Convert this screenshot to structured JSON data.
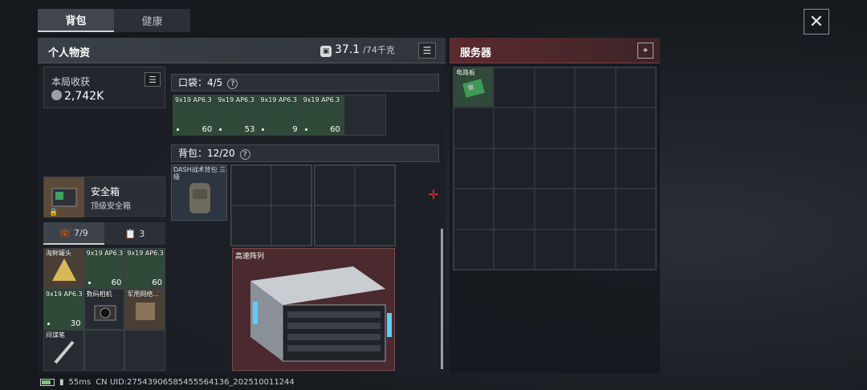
{
  "tabs": [
    {
      "label": "背包"
    },
    {
      "label": "健康"
    }
  ],
  "close_label": "✕",
  "personal": {
    "title": "个人物资",
    "weight_current": "37.1",
    "weight_max": "/74千克",
    "list_icon": "list-icon"
  },
  "server": {
    "title": "服务器",
    "item": "电路板",
    "pin_icon": "location-pin-icon"
  },
  "earnings": {
    "title": "本局收获",
    "value": "2,742K"
  },
  "safe": {
    "name": "安全箱",
    "sub": "顶级安全箱"
  },
  "subtabs": [
    {
      "label": "7/9",
      "icon": "briefcase-icon"
    },
    {
      "label": "3",
      "icon": "clipboard-icon"
    }
  ],
  "safe_items": [
    {
      "label": "海鲜罐头",
      "count": ""
    },
    {
      "label": "9x19 AP6.3",
      "count": "60"
    },
    {
      "label": "9x19 AP6.3",
      "count": "60"
    },
    {
      "label": "9x19 AP6.3",
      "count": "30"
    },
    {
      "label": "数码相机",
      "count": ""
    },
    {
      "label": "军用网络...",
      "count": ""
    },
    {
      "label": "间谍笔",
      "count": ""
    },
    {
      "label": "",
      "count": ""
    },
    {
      "label": "",
      "count": ""
    }
  ],
  "pocket": {
    "header": "口袋：4/5",
    "items": [
      {
        "label": "9x19 AP6.3",
        "count": "60"
      },
      {
        "label": "9x19 AP6.3",
        "count": "53"
      },
      {
        "label": "9x19 AP6.3",
        "count": "9"
      },
      {
        "label": "9x19 AP6.3",
        "count": "60"
      },
      {
        "label": "",
        "count": ""
      }
    ]
  },
  "bag": {
    "header": "背包：12/20",
    "backpack_label": "DASH战术背包 三级",
    "array_label": "高速阵列"
  },
  "status": {
    "ping": "55ms",
    "uid": "CN UID:27543906585455564136_202510011244"
  }
}
